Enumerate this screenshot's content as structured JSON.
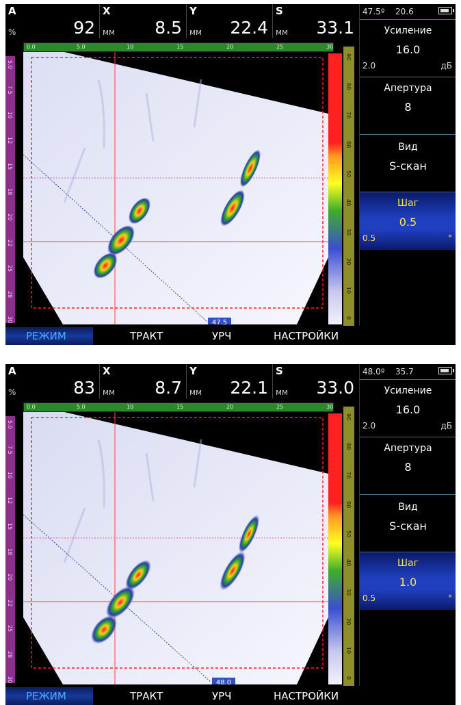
{
  "screens": [
    {
      "readouts": [
        {
          "letter": "A",
          "unit": "%",
          "value": "92"
        },
        {
          "letter": "X",
          "unit": "мм",
          "value": "8.5"
        },
        {
          "letter": "Y",
          "unit": "мм",
          "value": "22.4"
        },
        {
          "letter": "S",
          "unit": "мм",
          "value": "33.1"
        }
      ],
      "status": {
        "angle": "47.5º",
        "value": "20.6"
      },
      "params": [
        {
          "title": "Усиление",
          "value": "16.0",
          "min": "2.0",
          "unit": "дБ"
        },
        {
          "title": "Апертура",
          "value": "8"
        },
        {
          "title": "Вид",
          "value": "S-скан"
        },
        {
          "title": "Шаг",
          "value": "0.5",
          "min": "0.5",
          "unit": "°"
        }
      ],
      "angle_marker": "47.5",
      "menu": [
        "РЕЖИМ",
        "ТРАКТ",
        "УРЧ",
        "НАСТРОЙКИ"
      ]
    },
    {
      "readouts": [
        {
          "letter": "A",
          "unit": "%",
          "value": "83"
        },
        {
          "letter": "X",
          "unit": "мм",
          "value": "8.7"
        },
        {
          "letter": "Y",
          "unit": "мм",
          "value": "22.1"
        },
        {
          "letter": "S",
          "unit": "мм",
          "value": "33.0"
        }
      ],
      "status": {
        "angle": "48.0º",
        "value": "35.7"
      },
      "params": [
        {
          "title": "Усиление",
          "value": "16.0",
          "min": "2.0",
          "unit": "дБ"
        },
        {
          "title": "Апертура",
          "value": "8"
        },
        {
          "title": "Вид",
          "value": "S-скан"
        },
        {
          "title": "Шаг",
          "value": "1.0",
          "min": "0.5",
          "unit": "°"
        }
      ],
      "angle_marker": "48.0",
      "menu": [
        "РЕЖИМ",
        "ТРАКТ",
        "УРЧ",
        "НАСТРОЙКИ"
      ]
    }
  ],
  "ruler_x_labels": [
    "0.0",
    "5.0",
    "10",
    "15",
    "20",
    "25",
    "30"
  ],
  "ruler_y_labels": [
    "5.0",
    "7.5",
    "10",
    "12",
    "15",
    "18",
    "20",
    "22",
    "25",
    "28",
    "30"
  ],
  "color_scale_labels": [
    "90",
    "80",
    "70",
    "60",
    "50",
    "40",
    "30",
    "20",
    "10",
    "0"
  ],
  "colors": {
    "active_menu": "#4aa8ff",
    "active_param_text": "#ffe84a",
    "active_param_bg": "#1f3fbf",
    "ruler_x": "#2a8a2a",
    "ruler_y": "#8a2f8a",
    "cursor": "#ff2020",
    "gate": "#ff2020"
  }
}
